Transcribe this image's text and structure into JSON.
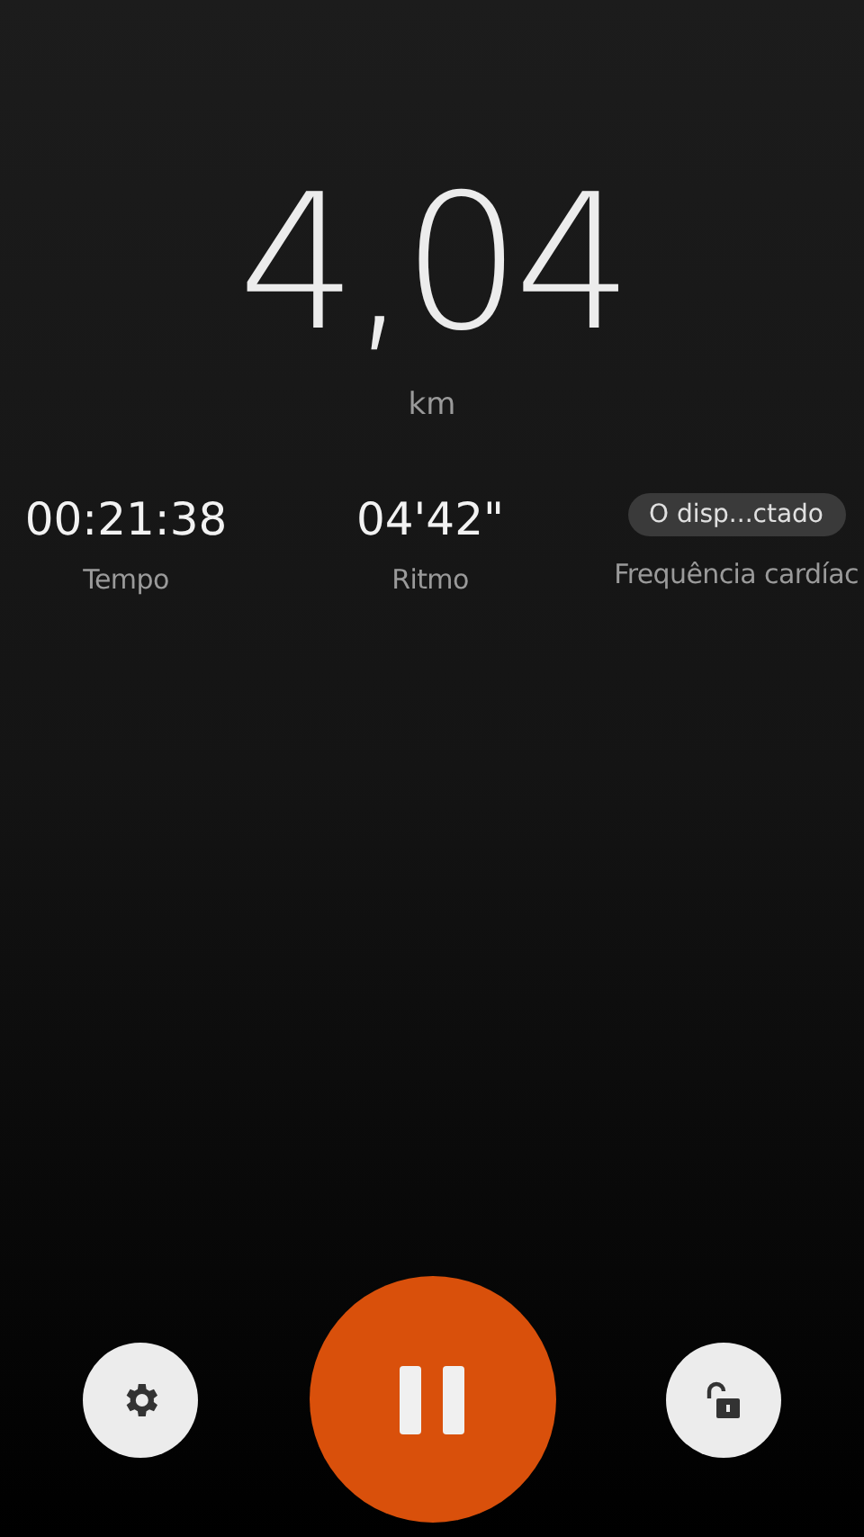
{
  "distance": {
    "value": "4,04",
    "unit": "km"
  },
  "stats": [
    {
      "kind": "value",
      "value": "00:21:38",
      "label": "Tempo"
    },
    {
      "kind": "value",
      "value": "04'42\"",
      "label": "Ritmo"
    },
    {
      "kind": "chip",
      "value": "O disp...ctado",
      "label": "Frequência cardíac"
    }
  ],
  "controls": [
    {
      "kind": "settings"
    },
    {
      "kind": "pause"
    },
    {
      "kind": "unlock"
    }
  ]
}
